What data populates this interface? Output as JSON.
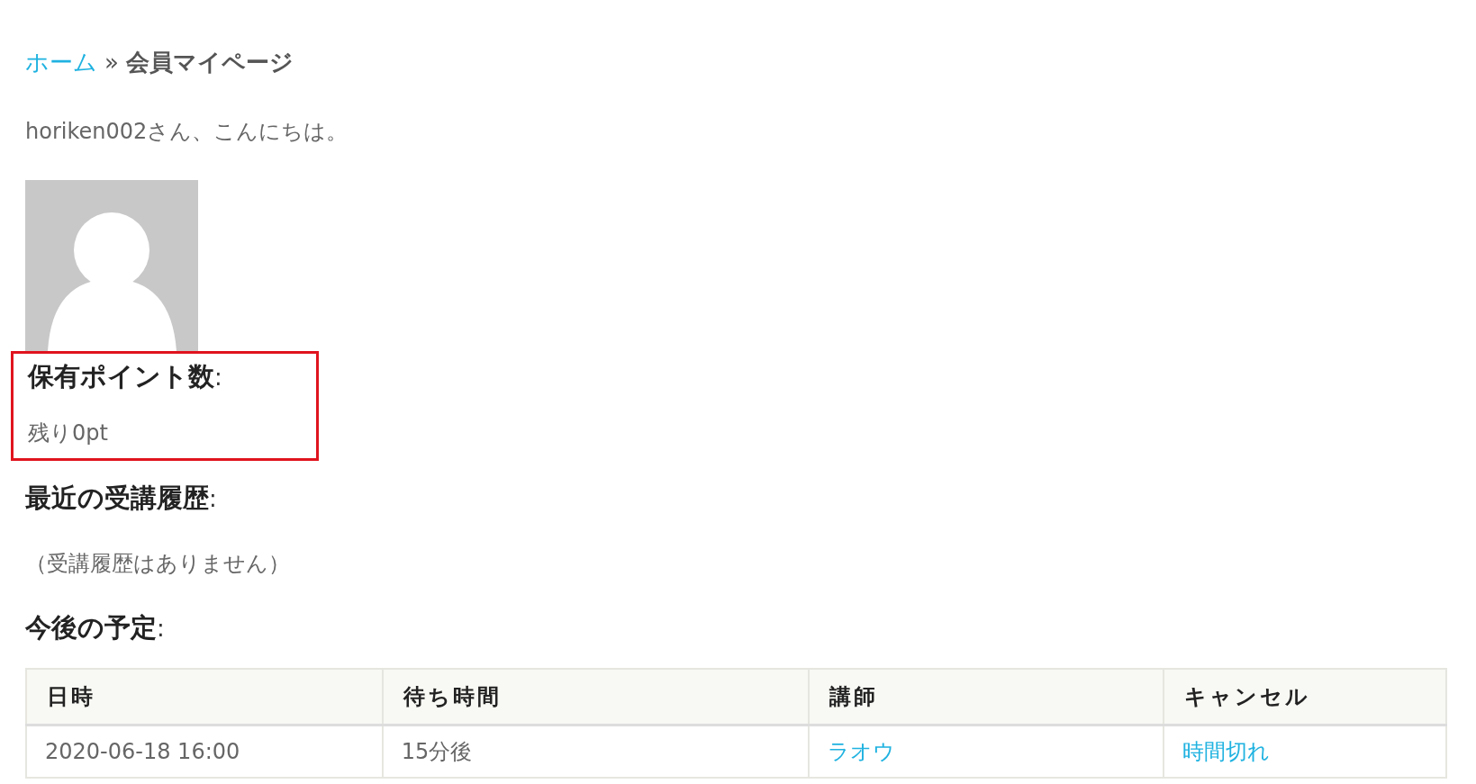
{
  "breadcrumb": {
    "home": "ホーム",
    "separator": "»",
    "current": "会員マイページ"
  },
  "greeting": "horiken002さん、こんにちは。",
  "points": {
    "heading": "保有ポイント数",
    "colon": ":",
    "value": "残り0pt",
    "highlighted": true
  },
  "history": {
    "heading": "最近の受講履歴",
    "colon": ":",
    "empty": "（受講履歴はありません）"
  },
  "schedule": {
    "heading": "今後の予定",
    "colon": ":",
    "table": {
      "columns": [
        "日時",
        "待ち時間",
        "講師",
        "キャンセル"
      ],
      "rows": [
        [
          {
            "text": "2020-06-18 16:00",
            "kind": "text"
          },
          {
            "text": "15分後",
            "kind": "text"
          },
          {
            "text": "ラオウ",
            "kind": "link"
          },
          {
            "text": "時間切れ",
            "kind": "link"
          }
        ]
      ]
    }
  }
}
